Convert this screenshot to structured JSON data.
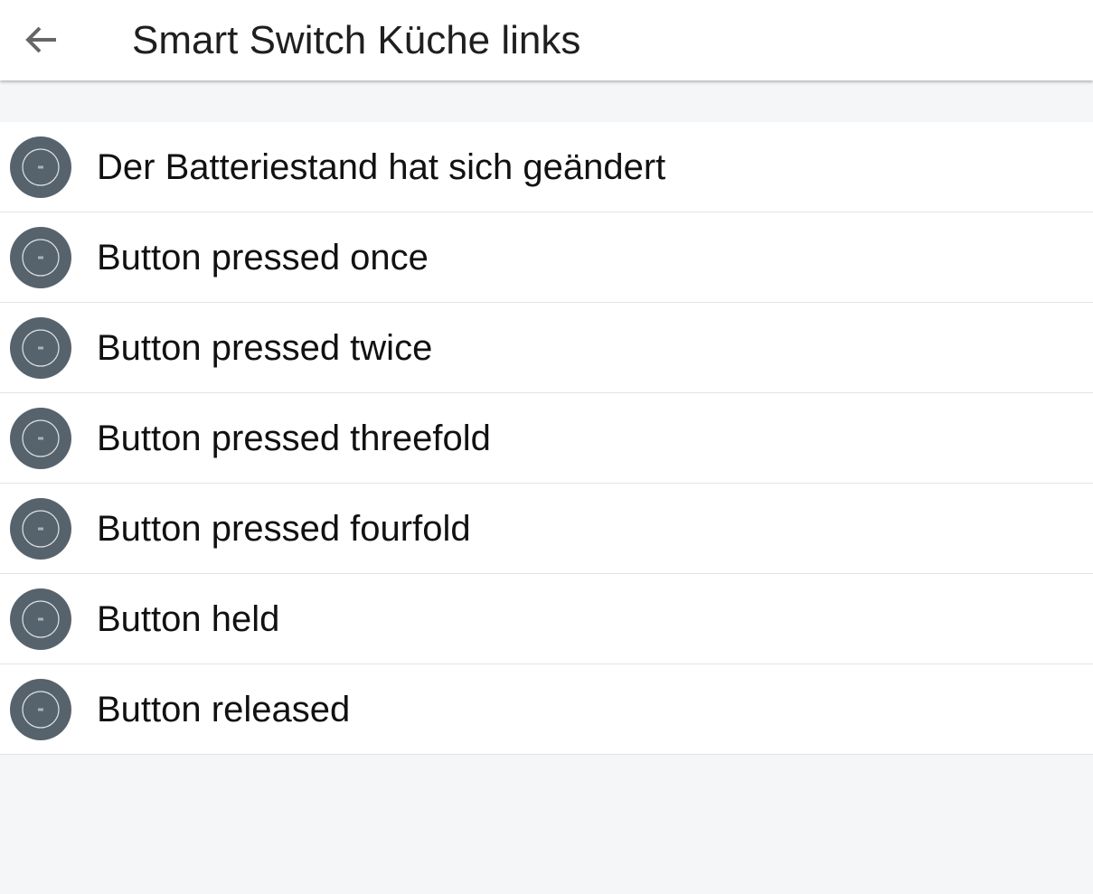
{
  "header": {
    "title": "Smart Switch Küche links",
    "back_icon": "arrow-left-icon"
  },
  "colors": {
    "header_bg": "#ffffff",
    "page_bg": "#f5f6f8",
    "icon_bg": "#57636c",
    "divider": "#e3e3e3"
  },
  "triggers": [
    {
      "label": "Der Batteriestand hat sich geändert",
      "icon": "smart-switch-icon"
    },
    {
      "label": "Button pressed once",
      "icon": "smart-switch-icon"
    },
    {
      "label": "Button pressed twice",
      "icon": "smart-switch-icon"
    },
    {
      "label": "Button pressed threefold",
      "icon": "smart-switch-icon"
    },
    {
      "label": "Button pressed fourfold",
      "icon": "smart-switch-icon"
    },
    {
      "label": "Button held",
      "icon": "smart-switch-icon"
    },
    {
      "label": "Button released",
      "icon": "smart-switch-icon"
    }
  ]
}
